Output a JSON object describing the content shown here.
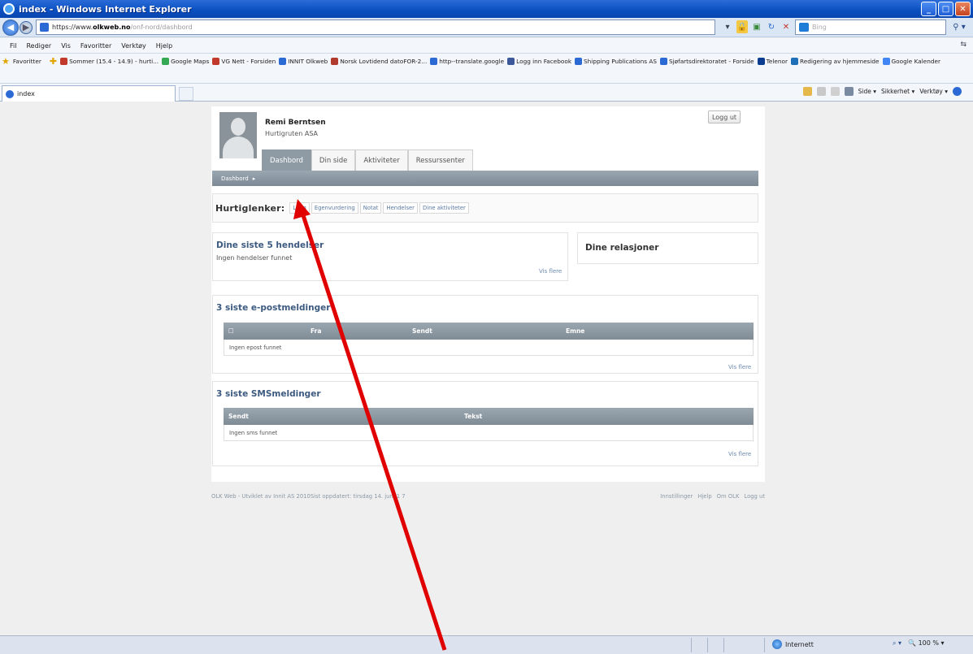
{
  "window": {
    "title": "index - Windows Internet Explorer",
    "min": "_",
    "max": "□",
    "close": "✕"
  },
  "address": {
    "scheme": "https://www.",
    "host": "olkweb.no",
    "path": "/onf-nord/dashbord"
  },
  "search": {
    "placeholder": "Bing"
  },
  "menu": [
    "Fil",
    "Rediger",
    "Vis",
    "Favoritter",
    "Verktøy",
    "Hjelp"
  ],
  "favorites": {
    "label": "Favoritter",
    "items": [
      {
        "label": "Sommer (15.4 - 14.9) - hurti...",
        "color": "#c0392b"
      },
      {
        "label": "Google Maps",
        "color": "#34a853"
      },
      {
        "label": "VG Nett - Forsiden",
        "color": "#c0392b"
      },
      {
        "label": "INNIT Olkweb",
        "color": "#2b6ad4"
      },
      {
        "label": "Norsk Lovtidend datoFOR-2...",
        "color": "#b03a2e"
      },
      {
        "label": "http--translate.google",
        "color": "#2b6ad4"
      },
      {
        "label": "Logg inn Facebook",
        "color": "#3b5998"
      },
      {
        "label": "Shipping Publications AS",
        "color": "#2b6ad4"
      },
      {
        "label": "Sjøfartsdirektoratet - Forside",
        "color": "#2b6ad4"
      },
      {
        "label": "Telenor",
        "color": "#0a3d8f"
      },
      {
        "label": "Redigering av hjemmeside",
        "color": "#1e6fb8"
      },
      {
        "label": "Google Kalender",
        "color": "#4285f4"
      }
    ]
  },
  "tab": {
    "label": "index"
  },
  "commandbar": [
    "Side ▾",
    "Sikkerhet ▾",
    "Verktøy ▾"
  ],
  "user": {
    "name": "Remi Berntsen",
    "company": "Hurtigruten ASA"
  },
  "logout_label": "Logg ut",
  "nav_tabs": [
    "Dashbord",
    "Din side",
    "Aktiviteter",
    "Ressurssenter"
  ],
  "breadcrumb": "Dashbord",
  "quicklinks": {
    "label": "Hurtiglenker:",
    "items": [
      "Logg",
      "Egenvurdering",
      "Notat",
      "Hendelser",
      "Dine aktiviteter"
    ]
  },
  "events": {
    "title": "Dine siste 5 hendelser",
    "empty": "Ingen hendelser funnet",
    "more": "Vis flere"
  },
  "relations": {
    "title": "Dine relasjoner"
  },
  "email": {
    "title": "3 siste e-postmeldinger",
    "columns": [
      "Fra",
      "Sendt",
      "Emne"
    ],
    "empty": "Ingen epost funnet",
    "more": "Vis flere"
  },
  "sms": {
    "title": "3 siste SMSmeldinger",
    "columns": [
      "Sendt",
      "Tekst"
    ],
    "empty": "Ingen sms funnet",
    "more": "Vis flere"
  },
  "footer": {
    "left": "OLK Web - Utviklet av Innit AS 2010Sist oppdatert: tirsdag 14. juni 1 7",
    "links": [
      "Innstillinger",
      "Hjelp",
      "Om OLK",
      "Logg ut"
    ]
  },
  "status": {
    "zone": "Internett",
    "zoom": "100 %"
  },
  "annotation": {
    "arrow_color": "#e00000"
  }
}
